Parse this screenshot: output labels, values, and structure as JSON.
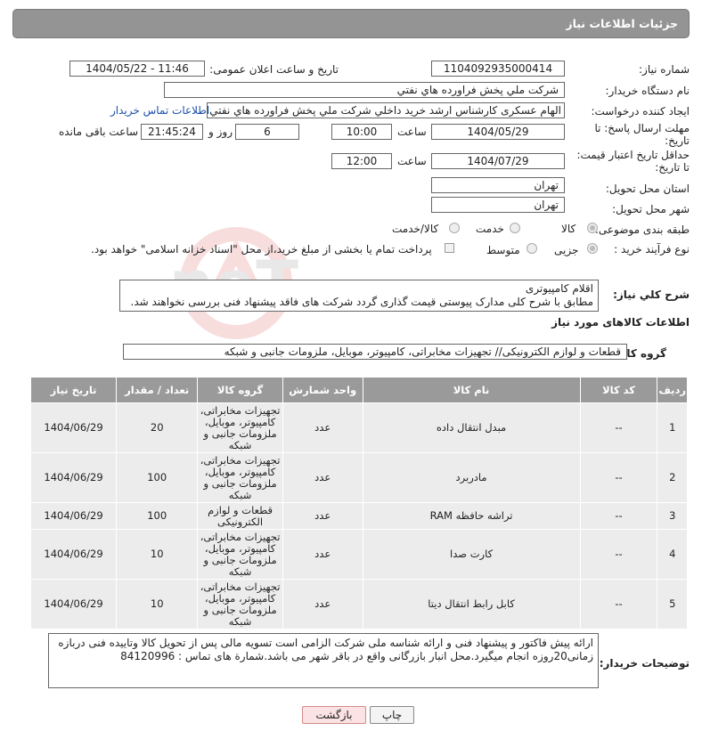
{
  "header_title": "جزئیات اطلاعات نیاز",
  "need_number_label": "شماره نیاز:",
  "need_number": "1104092935000414",
  "announce_label": "تاریخ و ساعت اعلان عمومی:",
  "announce_value": "1404/05/22 - 11:46",
  "buyer_org_label": "نام دستگاه خریدار:",
  "buyer_org": "شرکت ملي پخش فراورده هاي نفتي",
  "creator_label": "ایجاد کننده درخواست:",
  "creator": "الهام عسکری کارشناس ارشد خرید داخلي شرکت ملي پخش فراورده هاي نفتي",
  "buyer_contact_link": "اطلاعات تماس خریدار",
  "reply_deadline_label": "مهلت ارسال پاسخ: تا تاریخ:",
  "reply_date": "1404/05/29",
  "time_label": "ساعت",
  "reply_time": "10:00",
  "days_value": "6",
  "days_label": "روز و",
  "remaining_time": "21:45:24",
  "remaining_label": "ساعت باقی مانده",
  "price_validity_label": "حداقل تاریخ اعتبار قیمت: تا تاریخ:",
  "price_date": "1404/07/29",
  "price_time": "12:00",
  "province_label": "استان محل تحویل:",
  "province": "تهران",
  "city_label": "شهر محل تحویل:",
  "city": "تهران",
  "category_label": "طبقه بندی موضوعی:",
  "category_options": [
    "کالا",
    "خدمت",
    "کالا/خدمت"
  ],
  "process_label": "نوع فرآیند خرید :",
  "process_options": [
    "جزیی",
    "متوسط"
  ],
  "payment_note": "پرداخت تمام یا بخشی از مبلغ خرید،از محل \"اسناد خزانه اسلامی\" خواهد بود.",
  "desc_label": "شرح کلي نياز:",
  "desc_line1": "اقلام کامپیوتری",
  "desc_line2": "مطابق با شرح کلی مدارک پیوستی قیمت گذاری گردد شرکت های فاقد پیشنهاد فنی بررسی نخواهند شد.",
  "goods_info_title": "اطلاعات کالاهای مورد نیاز",
  "goods_group_label": "گروه کالا:",
  "goods_group": "قطعات و لوازم الکترونیکی// تجهیزات مخابراتی، کامپیوتر، موبایل، ملزومات جانبی و شبکه",
  "table": {
    "headers": [
      "ردیف",
      "کد کالا",
      "نام کالا",
      "واحد شمارش",
      "گروه کالا",
      "تعداد / مقدار",
      "تاریخ نیاز"
    ],
    "rows": [
      {
        "row": "1",
        "code": "--",
        "name": "مبدل انتقال داده",
        "unit": "عدد",
        "group": "تجهیزات مخابراتی، کامپیوتر، موبایل، ملزومات جانبی و شبکه",
        "qty": "20",
        "date": "1404/06/29"
      },
      {
        "row": "2",
        "code": "--",
        "name": "مادربرد",
        "unit": "عدد",
        "group": "تجهیزات مخابراتی، کامپیوتر، موبایل، ملزومات جانبی و شبکه",
        "qty": "100",
        "date": "1404/06/29"
      },
      {
        "row": "3",
        "code": "--",
        "name": "تراشه حافظه RAM",
        "unit": "عدد",
        "group": "قطعات و لوازم الکترونیکی",
        "qty": "100",
        "date": "1404/06/29"
      },
      {
        "row": "4",
        "code": "--",
        "name": "کارت صدا",
        "unit": "عدد",
        "group": "تجهیزات مخابراتی، کامپیوتر، موبایل، ملزومات جانبی و شبکه",
        "qty": "10",
        "date": "1404/06/29"
      },
      {
        "row": "5",
        "code": "--",
        "name": "کابل رابط انتقال دیتا",
        "unit": "عدد",
        "group": "تجهیزات مخابراتی، کامپیوتر، موبایل، ملزومات جانبی و شبکه",
        "qty": "10",
        "date": "1404/06/29"
      }
    ]
  },
  "buyer_notes_label": "توضیحات خریدار:",
  "buyer_notes_line1": "ارائه پیش فاکتور و پیشنهاد فنی و ارائه شناسه ملی شرکت الزامی است تسویه مالی پس از تحویل کالا وتاییده فنی دربازه",
  "buyer_notes_line2": "زمانی20روزه انجام میگیرد.محل انبار بازرگانی واقع در باقر شهر می باشد.شمارة های تماس : 84120996",
  "print_button": "چاپ",
  "back_button": "بازگشت",
  "watermark_text": "AriaTender.neT"
}
